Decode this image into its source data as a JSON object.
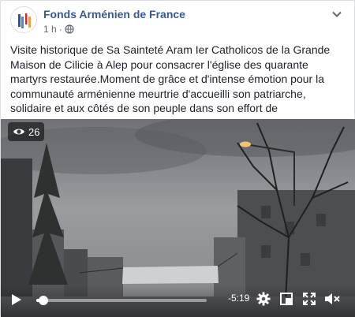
{
  "post": {
    "page_name": "Fonds Arménien de France",
    "timestamp": "1 h",
    "separator": "·",
    "privacy_icon": "globe-icon",
    "more_icon": "chevron-down-icon",
    "text": "Visite historique de Sa Sainteté Aram Ier Catholicos de la Grande Maison de Cilicie à Alep pour consacrer l'église des quarante martyrs restaurée.Moment de grâce et d'intense émotion pour la communauté arménienne meurtrie d'accueilli son patriarche, solidaire et aux côtés de son peuple dans son effort de reconstruction"
  },
  "video": {
    "view_icon": "eye-icon",
    "views": "26",
    "time_remaining": "-5:19",
    "progress": 0.04,
    "controls": [
      "play-icon",
      "settings-icon",
      "picture-in-picture-icon",
      "fullscreen-icon",
      "mute-icon"
    ]
  },
  "colors": {
    "link": "#385898",
    "text": "#1d2129",
    "meta": "#616770",
    "brand_blue": "#2f4fa3",
    "brand_red": "#d9262e"
  }
}
